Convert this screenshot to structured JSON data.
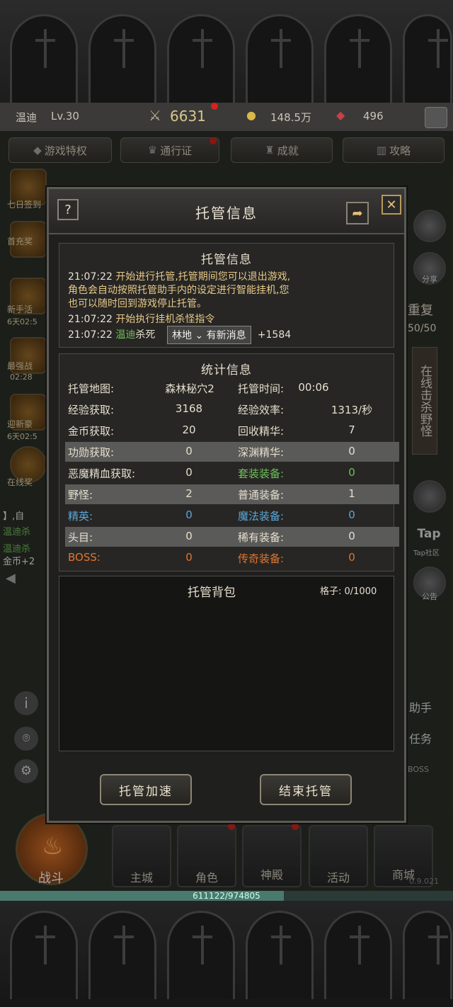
{
  "player": {
    "name": "温迪",
    "level": "Lv.30",
    "power": "6631",
    "gold": "148.5万",
    "gems": "496"
  },
  "top_tabs": [
    {
      "label": "游戏特权"
    },
    {
      "label": "通行证"
    },
    {
      "label": "成就"
    },
    {
      "label": "攻略"
    }
  ],
  "left_side": [
    {
      "label": "七日签到"
    },
    {
      "label": "首充奖"
    },
    {
      "label": "新手活",
      "sub": "6天02:5"
    },
    {
      "label": "最强战",
      "sub": "02:28"
    },
    {
      "label": "迎新豪",
      "sub": "6天02:5"
    },
    {
      "label": "在线奖"
    }
  ],
  "left_chat": [
    "】,自",
    "温迪杀",
    "温迪杀",
    "金币+2"
  ],
  "right_side": {
    "share_label": "分享",
    "repeat_label": "重复",
    "repeat_count": "50/50",
    "online_kill": "在线击杀野怪",
    "tap_label": "Tap社区",
    "notice_label": "公告",
    "task1": "助手",
    "task2": "任务",
    "boss": "BOSS"
  },
  "modal": {
    "title": "托管信息",
    "help_icon": "?",
    "log": {
      "title": "托管信息",
      "lines": [
        {
          "time": "21:07:22",
          "text": "开始进行托管,托管期间您可以退出游戏,"
        },
        {
          "time": "",
          "text": "角色会自动按照托管助手内的设定进行智能挂机,您"
        },
        {
          "time": "",
          "text": "也可以随时回到游戏停止托管。"
        },
        {
          "time": "21:07:22",
          "text": "开始执行挂机杀怪指令"
        },
        {
          "time": "21:07:22",
          "name": "温迪",
          "text": "杀死",
          "tail": "+1584"
        }
      ],
      "toast": "有新消息",
      "toast_prefix": "林地"
    },
    "stats": {
      "title": "统计信息",
      "rows": [
        {
          "l1": "托管地图:",
          "v1": "森林秘穴2",
          "l2": "托管时间:",
          "v2": "00:06"
        },
        {
          "l1": "经验获取:",
          "v1": "3168",
          "l2": "经验效率:",
          "v2": "1313/秒"
        },
        {
          "l1": "金币获取:",
          "v1": "20",
          "l2": "回收精华:",
          "v2": "7"
        },
        {
          "l1": "功勋获取:",
          "v1": "0",
          "l2": "深渊精华:",
          "v2": "0"
        },
        {
          "l1": "恶魔精血获取:",
          "v1": "0",
          "l2": "套装装备:",
          "v2": "0"
        },
        {
          "l1": "野怪:",
          "v1": "2",
          "l2": "普通装备:",
          "v2": "1"
        },
        {
          "l1": "精英:",
          "v1": "0",
          "l2": "魔法装备:",
          "v2": "0"
        },
        {
          "l1": "头目:",
          "v1": "0",
          "l2": "稀有装备:",
          "v2": "0"
        },
        {
          "l1": "BOSS:",
          "v1": "0",
          "l2": "传奇装备:",
          "v2": "0"
        }
      ]
    },
    "bag": {
      "title": "托管背包",
      "capacity": "格子: 0/1000"
    },
    "buttons": {
      "speed": "托管加速",
      "end": "结束托管"
    }
  },
  "colors": {
    "accent_gold": "#d2b46a",
    "green": "#6fbf5a",
    "elite_blue": "#5aa8d8",
    "magic_blue": "#5aa8d8",
    "boss_orange": "#e0762e",
    "set_green": "#6fbf5a"
  },
  "bottom_nav": [
    {
      "label": "战斗"
    },
    {
      "label": "主城"
    },
    {
      "label": "角色"
    },
    {
      "label": "神殿"
    },
    {
      "label": "活动"
    },
    {
      "label": "商城"
    }
  ],
  "xp": {
    "text": "611122/974805",
    "fraction": 0.627
  },
  "version": "0.9.021"
}
